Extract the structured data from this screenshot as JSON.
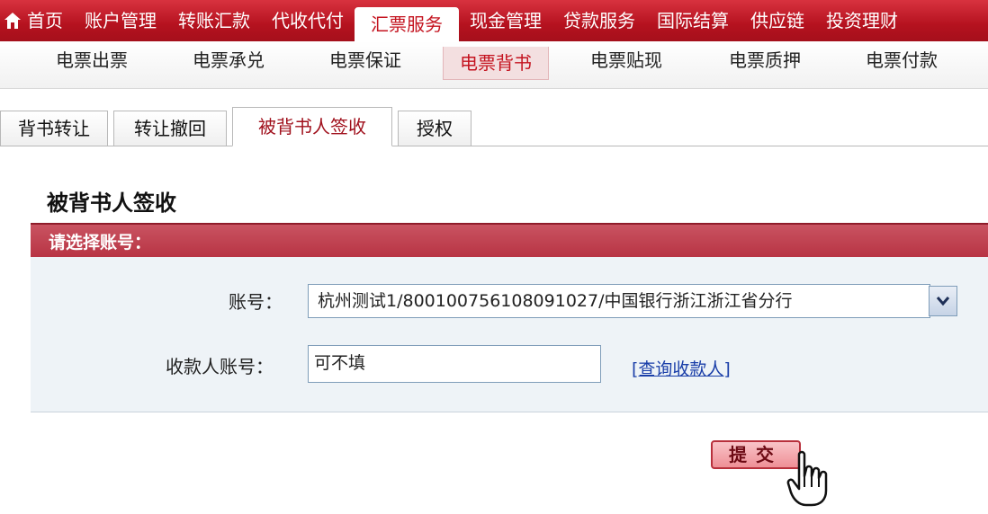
{
  "topnav": {
    "items": [
      "首页",
      "账户管理",
      "转账汇款",
      "代收代付",
      "汇票服务",
      "现金管理",
      "贷款服务",
      "国际结算",
      "供应链",
      "投资理财"
    ],
    "active_index": 4,
    "home_icon": "home-icon"
  },
  "subnav": {
    "items": [
      "电票出票",
      "电票承兑",
      "电票保证",
      "电票背书",
      "电票贴现",
      "电票质押",
      "电票付款"
    ],
    "active_index": 3
  },
  "tabs": {
    "items": [
      "背书转让",
      "转让撤回",
      "被背书人签收",
      "授权"
    ],
    "active_index": 2
  },
  "page": {
    "title": "被背书人签收",
    "section_label": "请选择账号："
  },
  "form": {
    "account_label": "账号：",
    "account_value": "杭州测试1/800100756108091027/中国银行浙江浙江省分行",
    "payee_label": "收款人账号：",
    "payee_placeholder": "可不填",
    "query_link": "[查询收款人]"
  },
  "actions": {
    "submit_label": "提交"
  },
  "colors": {
    "nav_red": "#b5121f",
    "section_bar": "#b83444",
    "form_bg": "#eef3f7",
    "link_blue": "#1a3ea8"
  }
}
